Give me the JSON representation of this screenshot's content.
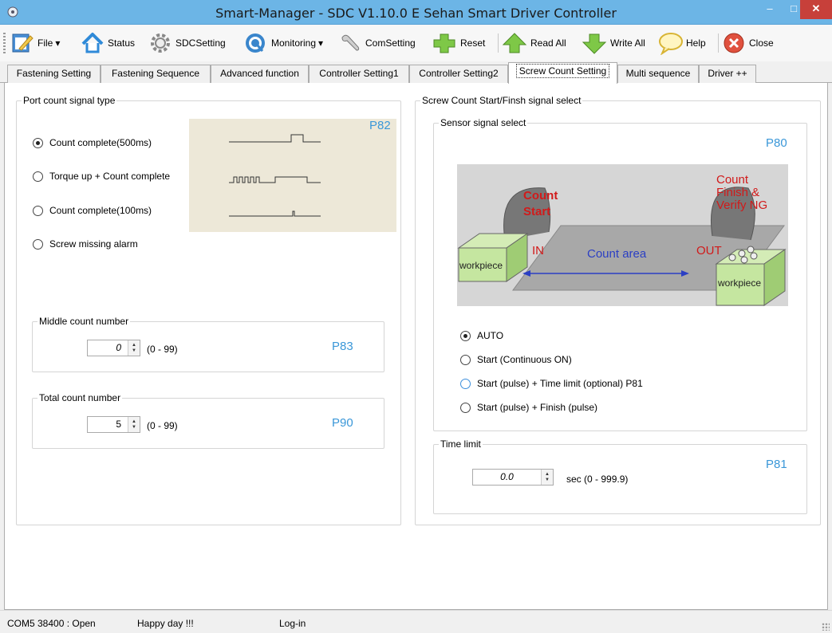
{
  "window": {
    "title": "Smart-Manager - SDC  V1.10.0 E  Sehan Smart Driver Controller",
    "min_glyph": "–",
    "max_glyph": "□",
    "close_glyph": "✕"
  },
  "toolbar": {
    "items": [
      {
        "label": "File",
        "icon": "file-icon",
        "dropdown": true
      },
      {
        "label": "Status",
        "icon": "home-icon"
      },
      {
        "label": "SDCSetting",
        "icon": "gear-icon"
      },
      {
        "label": "Monitoring",
        "icon": "monitor-icon",
        "dropdown": true
      },
      {
        "label": "ComSetting",
        "icon": "wrench-icon"
      },
      {
        "label": "Reset",
        "icon": "plus-icon"
      },
      {
        "label": "Read All",
        "icon": "arrow-up-icon"
      },
      {
        "label": "Write All",
        "icon": "arrow-down-icon"
      },
      {
        "label": "Help",
        "icon": "speech-bubble-icon"
      },
      {
        "label": "Close",
        "icon": "close-circle-icon"
      }
    ],
    "dropdown_glyph": "▾"
  },
  "tabs": [
    {
      "label": "Fastening Setting"
    },
    {
      "label": "Fastening Sequence"
    },
    {
      "label": "Advanced function"
    },
    {
      "label": "Controller Setting1"
    },
    {
      "label": "Controller Setting2"
    },
    {
      "label": "Screw Count Setting",
      "active": true
    },
    {
      "label": "Multi sequence"
    },
    {
      "label": "Driver ++"
    }
  ],
  "port_count": {
    "title": "Port count signal type",
    "pcode": "P82",
    "options": [
      {
        "label": "Count complete(500ms)",
        "checked": true
      },
      {
        "label": "Torque up + Count complete",
        "checked": false
      },
      {
        "label": "Count complete(100ms)",
        "checked": false
      },
      {
        "label": "Screw missing alarm",
        "checked": false
      }
    ]
  },
  "middle_count": {
    "title": "Middle count number",
    "value": "0",
    "range": "(0 - 99)",
    "pcode": "P83"
  },
  "total_count": {
    "title": "Total count number",
    "value": "5",
    "range": "(0 - 99)",
    "pcode": "P90"
  },
  "screw_signal": {
    "title": "Screw Count Start/Finsh signal select",
    "sensor_title": "Sensor signal select",
    "pcode": "P80",
    "diagram": {
      "count_start": [
        "Count",
        "Start"
      ],
      "count_finish": [
        "Count",
        "Finish &",
        "Verify NG"
      ],
      "in_label": "IN",
      "out_label": "OUT",
      "count_area": "Count area",
      "workpiece": "workpiece"
    },
    "options": [
      {
        "label": "AUTO",
        "checked": true
      },
      {
        "label": "Start (Continuous ON)",
        "checked": false
      },
      {
        "label": "Start (pulse) + Time limit (optional) P81",
        "checked": false,
        "focus": true
      },
      {
        "label": "Start (pulse) + Finish (pulse)",
        "checked": false
      }
    ]
  },
  "time_limit": {
    "title": "Time limit",
    "value": "0.0",
    "range": "sec (0 - 999.9)",
    "pcode": "P81"
  },
  "status": {
    "port": "COM5  38400 : Open",
    "message": "Happy day !!!",
    "login": "Log-in"
  },
  "colors": {
    "pcode": "#3a97d8",
    "titlebar": "#6cb5e6",
    "close_btn": "#c7403a"
  }
}
